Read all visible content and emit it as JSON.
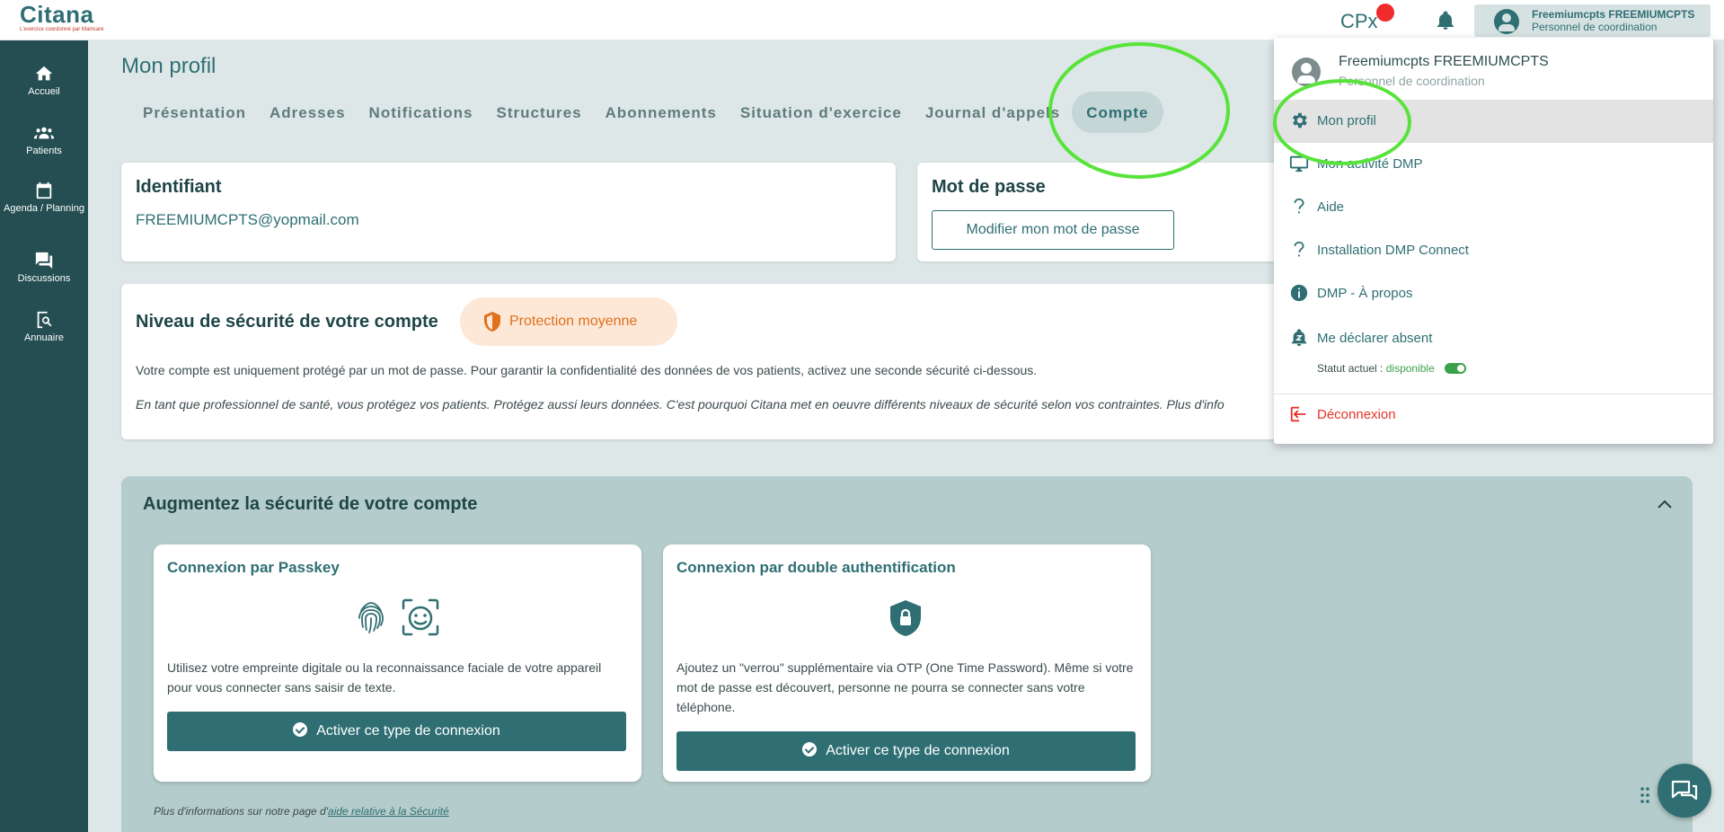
{
  "header": {
    "logo_title": "Citana",
    "logo_subtitle": "L'exercice coordonné par Maincare",
    "cpx_label": "CPx",
    "user_name": "Freemiumcpts FREEMIUMCPTS",
    "user_role": "Personnel de coordination"
  },
  "sidebar": {
    "items": [
      {
        "label": "Accueil",
        "icon": "home-icon"
      },
      {
        "label": "Patients",
        "icon": "users-icon"
      },
      {
        "label": "Agenda / Planning",
        "icon": "calendar-icon"
      },
      {
        "label": "Discussions",
        "icon": "chat-icon"
      },
      {
        "label": "Annuaire",
        "icon": "directory-search-icon"
      }
    ]
  },
  "page": {
    "title": "Mon profil",
    "tabs": [
      {
        "label": "Présentation",
        "active": false
      },
      {
        "label": "Adresses",
        "active": false
      },
      {
        "label": "Notifications",
        "active": false
      },
      {
        "label": "Structures",
        "active": false
      },
      {
        "label": "Abonnements",
        "active": false
      },
      {
        "label": "Situation d'exercice",
        "active": false
      },
      {
        "label": "Journal d'appels",
        "active": false
      },
      {
        "label": "Compte",
        "active": true
      }
    ]
  },
  "identifiant": {
    "title": "Identifiant",
    "value": "FREEMIUMCPTS@yopmail.com"
  },
  "password": {
    "title": "Mot de passe",
    "button": "Modifier mon mot de passe"
  },
  "security": {
    "title": "Niveau de sécurité de votre compte",
    "badge": "Protection moyenne",
    "text1": "Votre compte est uniquement protégé par un mot de passe. Pour garantir la confidentialité des données de vos patients, activez une seconde sécurité ci-dessous.",
    "text2": "En tant que professionnel de santé, vous protégez vos patients. Protégez aussi leurs données. C'est pourquoi Citana met en oeuvre différents niveaux de sécurité selon vos contraintes. Plus d'info"
  },
  "augment": {
    "title": "Augmentez la sécurité de votre compte",
    "passkey": {
      "title": "Connexion par Passkey",
      "desc": "Utilisez votre empreinte digitale ou la reconnaissance faciale de votre appareil pour vous connecter sans saisir de texte.",
      "button": "Activer ce type de connexion"
    },
    "twofa": {
      "title": "Connexion par double authentification",
      "desc": "Ajoutez un \"verrou\" supplémentaire via OTP (One Time Password). Même si votre mot de passe est découvert, personne ne pourra se connecter sans votre téléphone.",
      "button": "Activer ce type de connexion"
    },
    "footer_prefix": "Plus d'informations sur notre page d'",
    "footer_link": "aide relative à la Sécurité"
  },
  "dropdown": {
    "name": "Freemiumcpts FREEMIUMCPTS",
    "role": "Personnel de coordination",
    "items": [
      {
        "label": "Mon profil",
        "icon": "gear-icon",
        "active": true
      },
      {
        "label": "Mon activité DMP",
        "icon": "monitor-icon",
        "active": false
      },
      {
        "label": "Aide",
        "icon": "question-icon",
        "active": false
      },
      {
        "label": "Installation DMP Connect",
        "icon": "question-icon",
        "active": false
      },
      {
        "label": "DMP - À propos",
        "icon": "info-icon",
        "active": false
      },
      {
        "label": "Me déclarer absent",
        "icon": "bell-z-icon",
        "active": false
      }
    ],
    "status_label": "Statut actuel :",
    "status_value": "disponible",
    "logout": "Déconnexion"
  },
  "colors": {
    "primary": "#2f6f73",
    "sidebar": "#244e52",
    "background": "#dde7e7",
    "highlight": "#58e33a",
    "badge_text": "#e0701a",
    "logout": "#e4342a"
  }
}
